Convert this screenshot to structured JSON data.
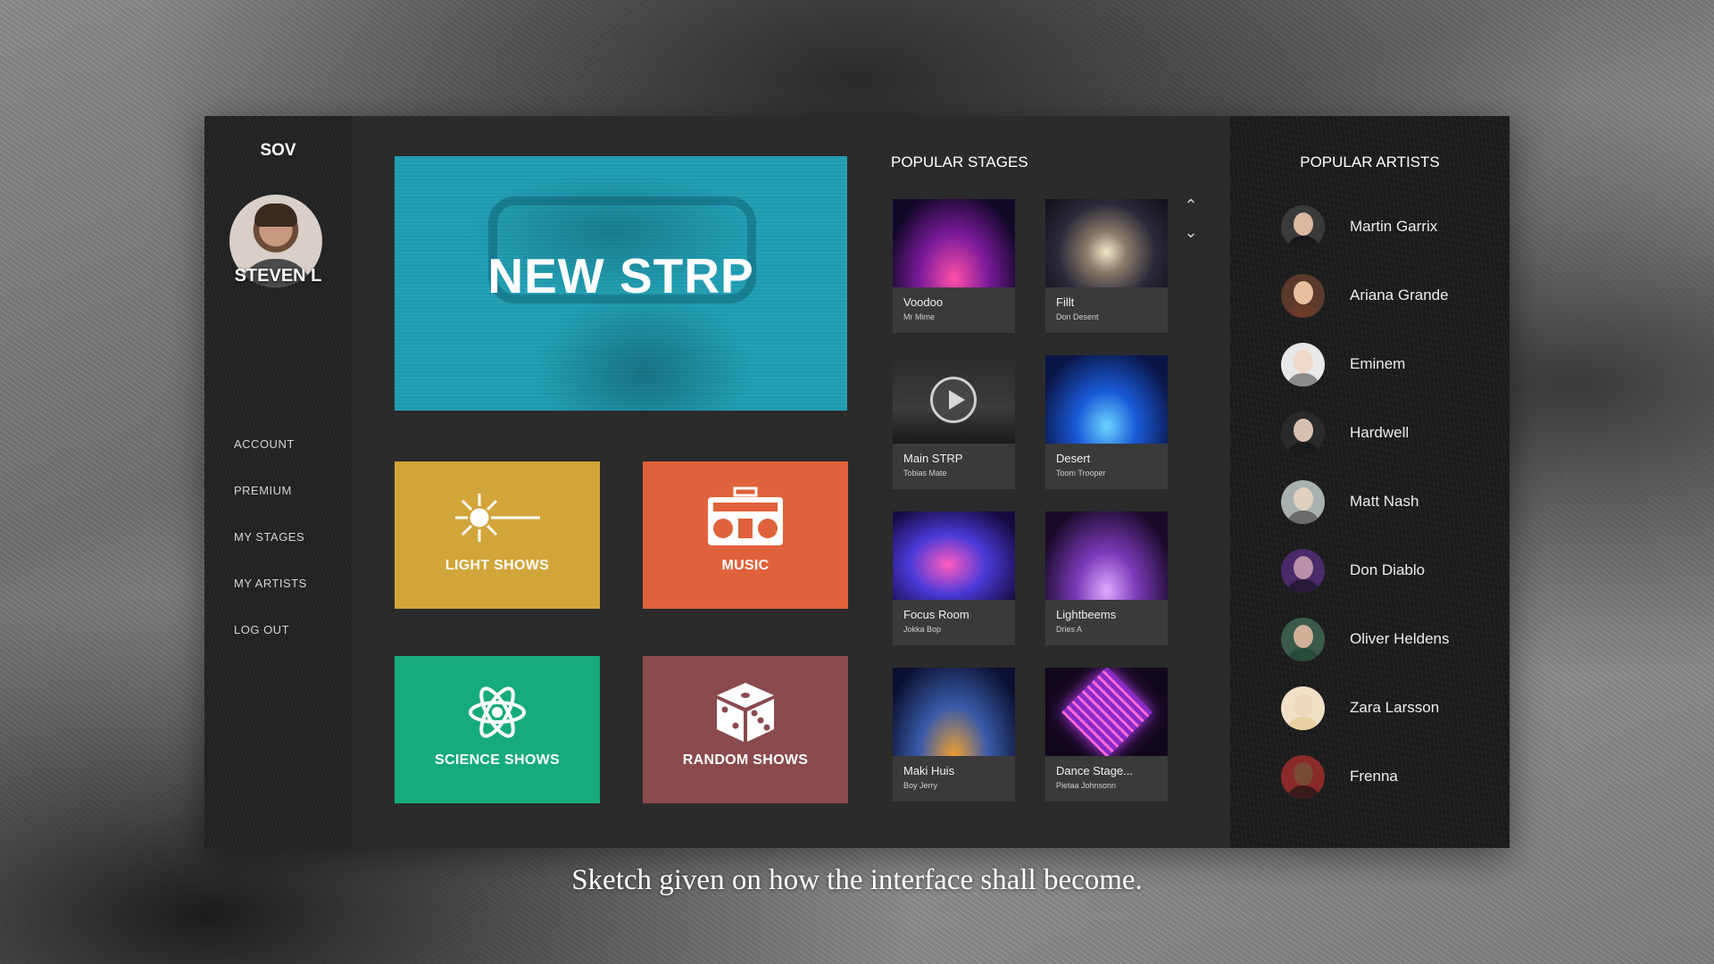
{
  "sidebar": {
    "logo": "SOV",
    "user_name": "STEVEN L",
    "nav": [
      "ACCOUNT",
      "PREMIUM",
      "MY STAGES",
      "MY ARTISTS",
      "LOG OUT"
    ]
  },
  "hero": {
    "title": "NEW STRP"
  },
  "tiles": [
    {
      "label": "LIGHT SHOWS",
      "icon": "laser-burst-icon",
      "color": "#d2a53a"
    },
    {
      "label": "MUSIC",
      "icon": "boombox-icon",
      "color": "#e0623a"
    },
    {
      "label": "SCIENCE SHOWS",
      "icon": "atom-icon",
      "color": "#16ab7c"
    },
    {
      "label": "RANDOM SHOWS",
      "icon": "dice-icon",
      "color": "#8a4a4e"
    }
  ],
  "stages": {
    "title": "POPULAR STAGES",
    "items": [
      {
        "name": "Voodoo",
        "artist": "Mr Mime"
      },
      {
        "name": "Fillt",
        "artist": "Don Desent"
      },
      {
        "name": "Main STRP",
        "artist": "Tobias Mate"
      },
      {
        "name": "Desert",
        "artist": "Toom Trooper"
      },
      {
        "name": "Focus Room",
        "artist": "Jokka Bop"
      },
      {
        "name": "Lightbeems",
        "artist": "Dries A"
      },
      {
        "name": "Maki Huis",
        "artist": "Boy Jerry"
      },
      {
        "name": "Dance Stage...",
        "artist": "Pietaa Johnsonn"
      }
    ]
  },
  "artists": {
    "title": "POPULAR ARTISTS",
    "items": [
      "Martin Garrix",
      "Ariana Grande",
      "Eminem",
      "Hardwell",
      "Matt Nash",
      "Don Diablo",
      "Oliver Heldens",
      "Zara Larsson",
      "Frenna"
    ]
  },
  "caption": "Sketch given on how the interface shall become."
}
